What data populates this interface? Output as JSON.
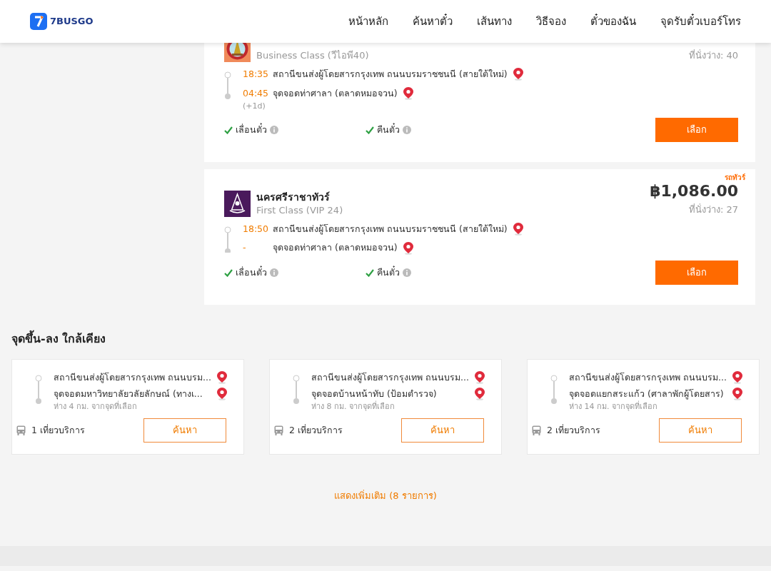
{
  "header": {
    "logo": "7BUSGO",
    "nav": [
      {
        "label": "หน้าหลัก"
      },
      {
        "label": "ค้นหาตั๋ว"
      },
      {
        "label": "เส้นทาง"
      },
      {
        "label": "วิธีจอง"
      },
      {
        "label": "ตั๋วของฉัน"
      },
      {
        "label": "จุดรับตั๋วเบอร์โทร"
      }
    ]
  },
  "trips": [
    {
      "kind": "temple",
      "bus_class": "Business Class (วีไอพี40)",
      "seats": "ที่นั่งว่าง: 40",
      "depart_time": "18:35",
      "depart_stop": "สถานีขนส่งผู้โดยสารกรุงเทพ ถนนบรมราชชนนี (สายใต้ใหม่)",
      "arrive_time": "04:45",
      "arrive_note": "(+1d)",
      "arrive_stop": "จุดจอดท่าศาลา (ตลาดหมอจวน)",
      "features": [
        {
          "label": "เลื่อนตั๋ว",
          "available": true
        },
        {
          "label": "คืนตั๋ว",
          "available": true
        }
      ],
      "button": "เลือก"
    },
    {
      "kind": "crest",
      "tag": "รถทัวร์",
      "operator": "นครศรีราชาทัวร์",
      "bus_class": "First Class (VIP 24)",
      "price": "฿1,086.00",
      "seats": "ที่นั่งว่าง: 27",
      "depart_time": "18:50",
      "depart_stop": "สถานีขนส่งผู้โดยสารกรุงเทพ ถนนบรมราชชนนี (สายใต้ใหม่)",
      "arrive_time": "-",
      "arrive_stop": "จุดจอดท่าศาลา (ตลาดหมอจวน)",
      "features": [
        {
          "label": "เลื่อนตั๋ว",
          "available": true
        },
        {
          "label": "คืนตั๋ว",
          "available": true
        }
      ],
      "button": "เลือก"
    }
  ],
  "nearby": {
    "title": "จุดขึ้น-ลง ใกล้เคียง",
    "items": [
      {
        "from": "สถานีขนส่งผู้โดยสารกรุงเทพ ถนนบรม...",
        "to": "จุดจอดมหาวิทยาลัยวลัยลักษณ์ (ทางเ...",
        "distance": "ห่าง 4 กม. จากจุดที่เลือก",
        "trips": "1 เที่ยวบริการ",
        "button": "ค้นหา"
      },
      {
        "from": "สถานีขนส่งผู้โดยสารกรุงเทพ ถนนบรม...",
        "to": "จุดจอดบ้านหน้าทับ (ป้อมตำรวจ)",
        "distance": "ห่าง 8 กม. จากจุดที่เลือก",
        "trips": "2 เที่ยวบริการ",
        "button": "ค้นหา"
      },
      {
        "from": "สถานีขนส่งผู้โดยสารกรุงเทพ ถนนบรม...",
        "to": "จุดจอดแยกสระแก้ว (ศาลาพักผู้โดยสาร)",
        "distance": "ห่าง 14 กม. จากจุดที่เลือก",
        "trips": "2 เที่ยวบริการ",
        "button": "ค้นหา"
      }
    ],
    "more": "แสดงเพิ่มเติม (8 รายการ)"
  }
}
